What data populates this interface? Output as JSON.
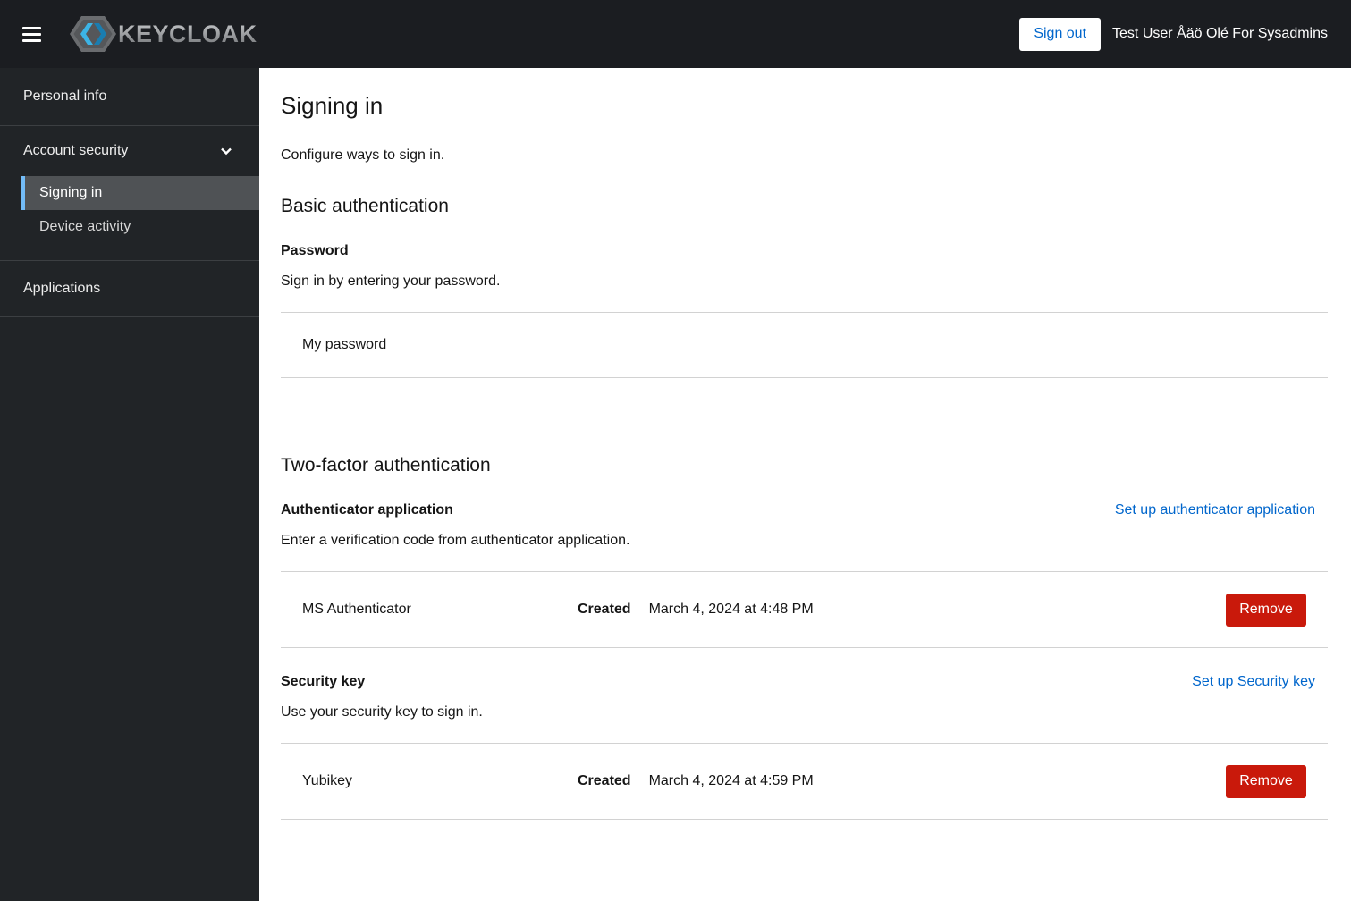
{
  "header": {
    "brand": "KEYCLOAK",
    "sign_out_label": "Sign out",
    "username": "Test User Åäö Olé For Sysadmins"
  },
  "sidebar": {
    "items": [
      {
        "label": "Personal info"
      },
      {
        "label": "Account security",
        "expanded": true,
        "children": [
          {
            "label": "Signing in",
            "active": true
          },
          {
            "label": "Device activity"
          }
        ]
      },
      {
        "label": "Applications"
      }
    ]
  },
  "main": {
    "title": "Signing in",
    "description": "Configure ways to sign in.",
    "basic_auth": {
      "title": "Basic authentication",
      "password": {
        "title": "Password",
        "description": "Sign in by entering your password.",
        "row_label": "My password"
      }
    },
    "two_factor": {
      "title": "Two-factor authentication",
      "authenticator": {
        "title": "Authenticator application",
        "setup_link": "Set up authenticator application",
        "description": "Enter a verification code from authenticator application.",
        "row": {
          "name": "MS Authenticator",
          "created_label": "Created",
          "created_value": "March 4, 2024 at 4:48 PM",
          "remove_label": "Remove"
        }
      },
      "security_key": {
        "title": "Security key",
        "setup_link": "Set up Security key",
        "description": "Use your security key to sign in.",
        "row": {
          "name": "Yubikey",
          "created_label": "Created",
          "created_value": "March 4, 2024 at 4:59 PM",
          "remove_label": "Remove"
        }
      }
    }
  },
  "colors": {
    "masthead_bg": "#1b1d21",
    "sidebar_bg": "#212427",
    "sidebar_active_bg": "#4f5255",
    "sidebar_active_accent": "#73bcf7",
    "link": "#0066cc",
    "danger": "#c9190b",
    "divider": "#d2d2d2"
  }
}
